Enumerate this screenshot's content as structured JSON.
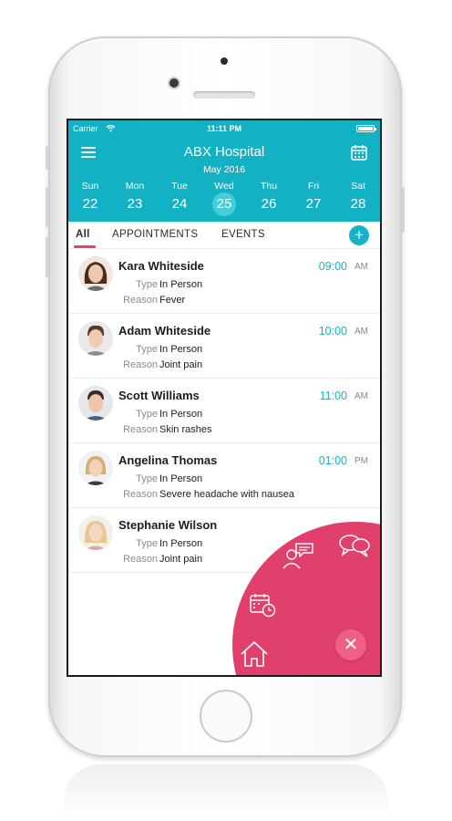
{
  "status": {
    "carrier": "Carrier",
    "time": "11:11 PM"
  },
  "header": {
    "title": "ABX Hospital",
    "subtitle": "May 2016"
  },
  "days": [
    {
      "name": "Sun",
      "num": "22"
    },
    {
      "name": "Mon",
      "num": "23"
    },
    {
      "name": "Tue",
      "num": "24"
    },
    {
      "name": "Wed",
      "num": "25"
    },
    {
      "name": "Thu",
      "num": "26"
    },
    {
      "name": "Fri",
      "num": "27"
    },
    {
      "name": "Sat",
      "num": "28"
    }
  ],
  "selected_day": "25",
  "tabs": [
    {
      "label": "All",
      "active": true
    },
    {
      "label": "APPOINTMENTS",
      "active": false
    },
    {
      "label": "EVENTS",
      "active": false
    }
  ],
  "labels": {
    "type": "Type",
    "reason": "Reason"
  },
  "appointments": [
    {
      "name": "Kara Whiteside",
      "time": "09:00",
      "ampm": "AM",
      "type": "In Person",
      "reason": "Fever"
    },
    {
      "name": "Adam Whiteside",
      "time": "10:00",
      "ampm": "AM",
      "type": "In Person",
      "reason": "Joint pain"
    },
    {
      "name": "Scott Williams",
      "time": "11:00",
      "ampm": "AM",
      "type": "In Person",
      "reason": "Skin rashes"
    },
    {
      "name": "Angelina Thomas",
      "time": "01:00",
      "ampm": "PM",
      "type": "In Person",
      "reason": "Severe headache with nausea"
    },
    {
      "name": "Stephanie Wilson",
      "time": "",
      "ampm": "",
      "type": "In Person",
      "reason": "Joint pain"
    }
  ],
  "colors": {
    "header": "#13b1c4",
    "accent": "#16b3c8",
    "fab": "#e2406c",
    "tab_underline": "#e04868"
  },
  "icons": {
    "menu": "hamburger-menu-icon",
    "calendar": "calendar-icon",
    "add": "add-icon",
    "close": "close-icon",
    "fab_items": [
      "user-chat-icon",
      "chat-bubbles-icon",
      "calendar-alarm-icon",
      "home-icon"
    ]
  }
}
